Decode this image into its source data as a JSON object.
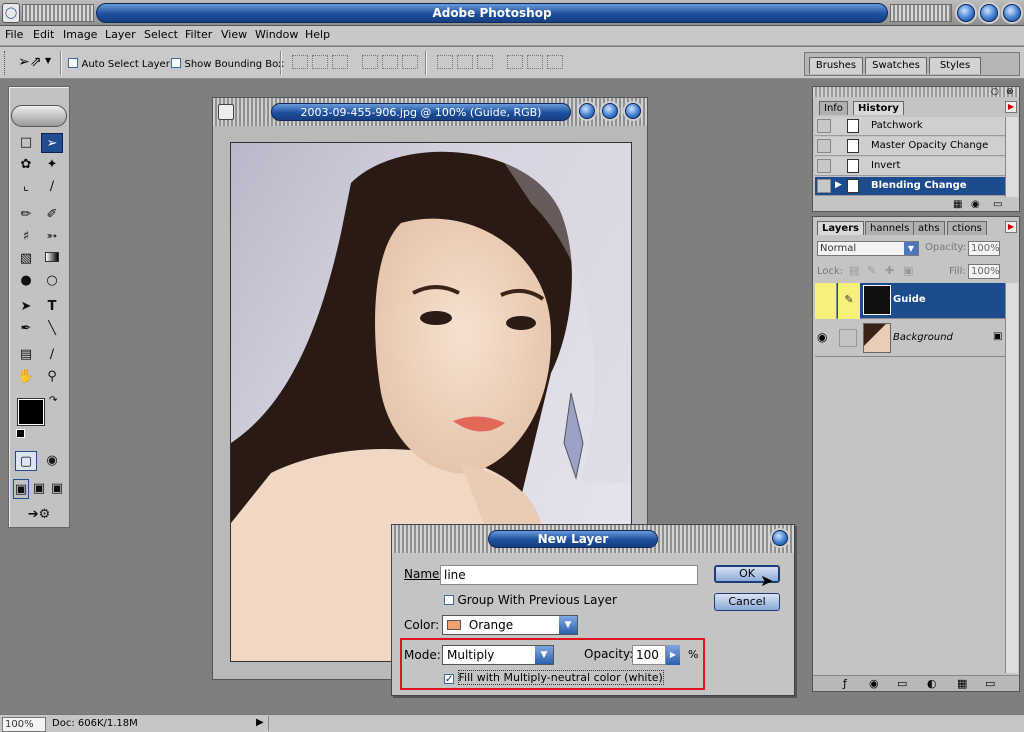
{
  "app": {
    "title": "Adobe Photoshop",
    "menus": [
      "File",
      "Edit",
      "Image",
      "Layer",
      "Select",
      "Filter",
      "View",
      "Window",
      "Help"
    ]
  },
  "options_bar": {
    "auto_select_layer": "Auto Select Layer",
    "show_bounding_box": "Show Bounding Box"
  },
  "palette_well": {
    "tabs": [
      "Brushes",
      "Swatches",
      "Styles"
    ]
  },
  "document": {
    "title": "2003-09-455-906.jpg @ 100% (Guide, RGB)"
  },
  "history": {
    "tabs": [
      "Info",
      "History"
    ],
    "items": [
      {
        "label": "Patchwork"
      },
      {
        "label": "Master Opacity Change"
      },
      {
        "label": "Invert"
      },
      {
        "label": "Blending Change"
      }
    ]
  },
  "layers": {
    "tabs": [
      "Layers",
      "Channels",
      "Paths",
      "Actions"
    ],
    "tab_visible_labels": [
      "Layers",
      "hannels",
      "aths",
      "ctions"
    ],
    "blend_mode": "Normal",
    "opacity_label": "Opacity:",
    "opacity_value": "100%",
    "lock_label": "Lock:",
    "fill_label": "Fill:",
    "fill_value": "100%",
    "items": [
      {
        "name": "Guide",
        "selected": true
      },
      {
        "name": "Background",
        "selected": false
      }
    ]
  },
  "status": {
    "zoom": "100%",
    "doc": "Doc: 606K/1.18M"
  },
  "dialog": {
    "title": "New Layer",
    "name_label": "Name:",
    "name_value": "line",
    "group_label": "Group With Previous Layer",
    "color_label": "Color:",
    "color_value": "Orange",
    "color_swatch": "#f0a070",
    "mode_label": "Mode:",
    "mode_value": "Multiply",
    "opacity_label": "Opacity:",
    "opacity_value": "100",
    "opacity_unit": "%",
    "fill_label": "Fill with Multiply-neutral color (white)",
    "ok_label": "OK",
    "cancel_label": "Cancel",
    "highlight_color": "#e0141e"
  },
  "colors": {
    "accent_blue": "#1c4b8e",
    "panel_gray": "#c4c4c4",
    "foreground_color": "#000000",
    "background_color": "#ffffff"
  }
}
